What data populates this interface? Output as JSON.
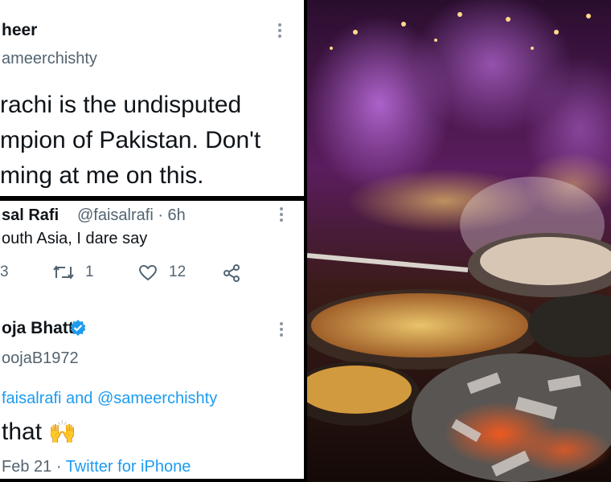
{
  "tweet1": {
    "name": "heer",
    "handle": "ameerchishty",
    "lines": [
      "rachi is the undisputed",
      "mpion of Pakistan. Don't",
      "ming at me on this."
    ]
  },
  "reply1": {
    "name": "sal Rafi",
    "meta": "@faisalrafi · 6h",
    "text": "outh Asia, I dare say",
    "reply_count": "3",
    "retweet_count": "1",
    "like_count": "12"
  },
  "tweet2": {
    "name": "oja Bhatt",
    "handle": "oojaB1972",
    "mentions": "faisalrafi and @sameerchishty",
    "text": "that",
    "emoji": "🙌",
    "date": "Feb 21",
    "source": "Twitter for iPhone"
  },
  "colors": {
    "accent": "#1d9bf0",
    "text": "#0f1419",
    "muted": "#536471",
    "verified": "#1d9bf0"
  },
  "icons": [
    "more-icon",
    "retweet-icon",
    "heart-icon",
    "share-icon",
    "verified-icon",
    "raised-hands-emoji"
  ]
}
